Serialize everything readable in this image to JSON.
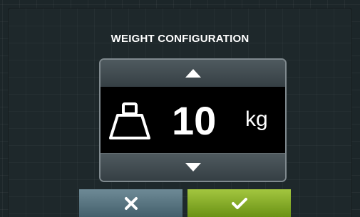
{
  "dialog": {
    "title": "WEIGHT CONFIGURATION",
    "value": "10",
    "unit": "kg"
  },
  "icons": {
    "increase": "triangle-up-icon",
    "decrease": "triangle-down-icon",
    "weight": "weight-icon",
    "cancel": "x-icon",
    "confirm": "checkmark-icon"
  },
  "colors": {
    "background": "#1c2629",
    "stepper_frame": "#7f898e",
    "arrow_button": "#4f5a5f",
    "cancel_button": "#5a7581",
    "confirm_button": "#8cb12b",
    "text": "#ffffff"
  }
}
